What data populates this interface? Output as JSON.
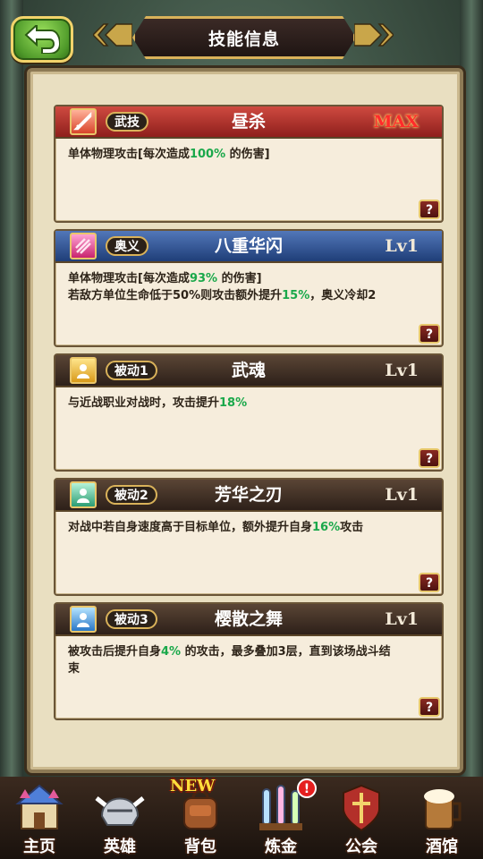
{
  "header": {
    "title": "技能信息",
    "back_icon": "back-arrow-icon"
  },
  "skills": [
    {
      "tag": "武技",
      "name": "昼杀",
      "level": "MAX",
      "icon": "sword-icon",
      "desc": [
        {
          "lines": [
            [
              {
                "t": "单体物理攻击[每次造成"
              },
              {
                "t": "100%",
                "hl": true
              },
              {
                "t": " 的伤害]"
              }
            ]
          ]
        }
      ]
    },
    {
      "tag": "奥义",
      "name": "八重华闪",
      "level": "Lv1",
      "icon": "slash-icon",
      "desc": [
        {
          "lines": [
            [
              {
                "t": "单体物理攻击[每次造成"
              },
              {
                "t": "93%",
                "hl": true
              },
              {
                "t": " 的伤害]"
              }
            ],
            [
              {
                "t": "若敌方单位生命低于50%则攻击额外提升"
              },
              {
                "t": "15%",
                "hl": true
              },
              {
                "t": "，奥义冷却2"
              }
            ]
          ]
        }
      ]
    },
    {
      "tag": "被动1",
      "name": "武魂",
      "level": "Lv1",
      "icon": "spirit-icon",
      "desc": [
        {
          "lines": [
            [
              {
                "t": "与近战职业对战时，攻击提升"
              },
              {
                "t": "18%",
                "hl": true
              }
            ]
          ]
        }
      ]
    },
    {
      "tag": "被动2",
      "name": "芳华之刃",
      "level": "Lv1",
      "icon": "aura-icon",
      "desc": [
        {
          "lines": [
            [
              {
                "t": "对战中若自身速度高于目标单位，额外提升自身"
              },
              {
                "t": "16%",
                "hl": true
              },
              {
                "t": "攻击"
              }
            ]
          ]
        }
      ]
    },
    {
      "tag": "被动3",
      "name": "樱散之舞",
      "level": "Lv1",
      "icon": "blossom-icon",
      "desc": [
        {
          "lines": [
            [
              {
                "t": "被攻击后提升自身"
              },
              {
                "t": "4%",
                "hl": true
              },
              {
                "t": " 的攻击，最多叠加3层，直到该场战斗结"
              }
            ],
            [
              {
                "t": "束"
              }
            ]
          ]
        }
      ]
    }
  ],
  "help_label": "?",
  "nav": [
    {
      "label": "主页",
      "icon": "castle-icon"
    },
    {
      "label": "英雄",
      "icon": "knight-helmet-icon"
    },
    {
      "label": "背包",
      "icon": "backpack-icon",
      "badge": "NEW"
    },
    {
      "label": "炼金",
      "icon": "potion-flasks-icon",
      "alert": "!"
    },
    {
      "label": "公会",
      "icon": "guild-shield-icon"
    },
    {
      "label": "酒馆",
      "icon": "beer-mug-icon"
    }
  ],
  "colors": {
    "highlight": "#1aa84a",
    "max": "#ff2b2b",
    "panel": "#e9dfc1"
  }
}
